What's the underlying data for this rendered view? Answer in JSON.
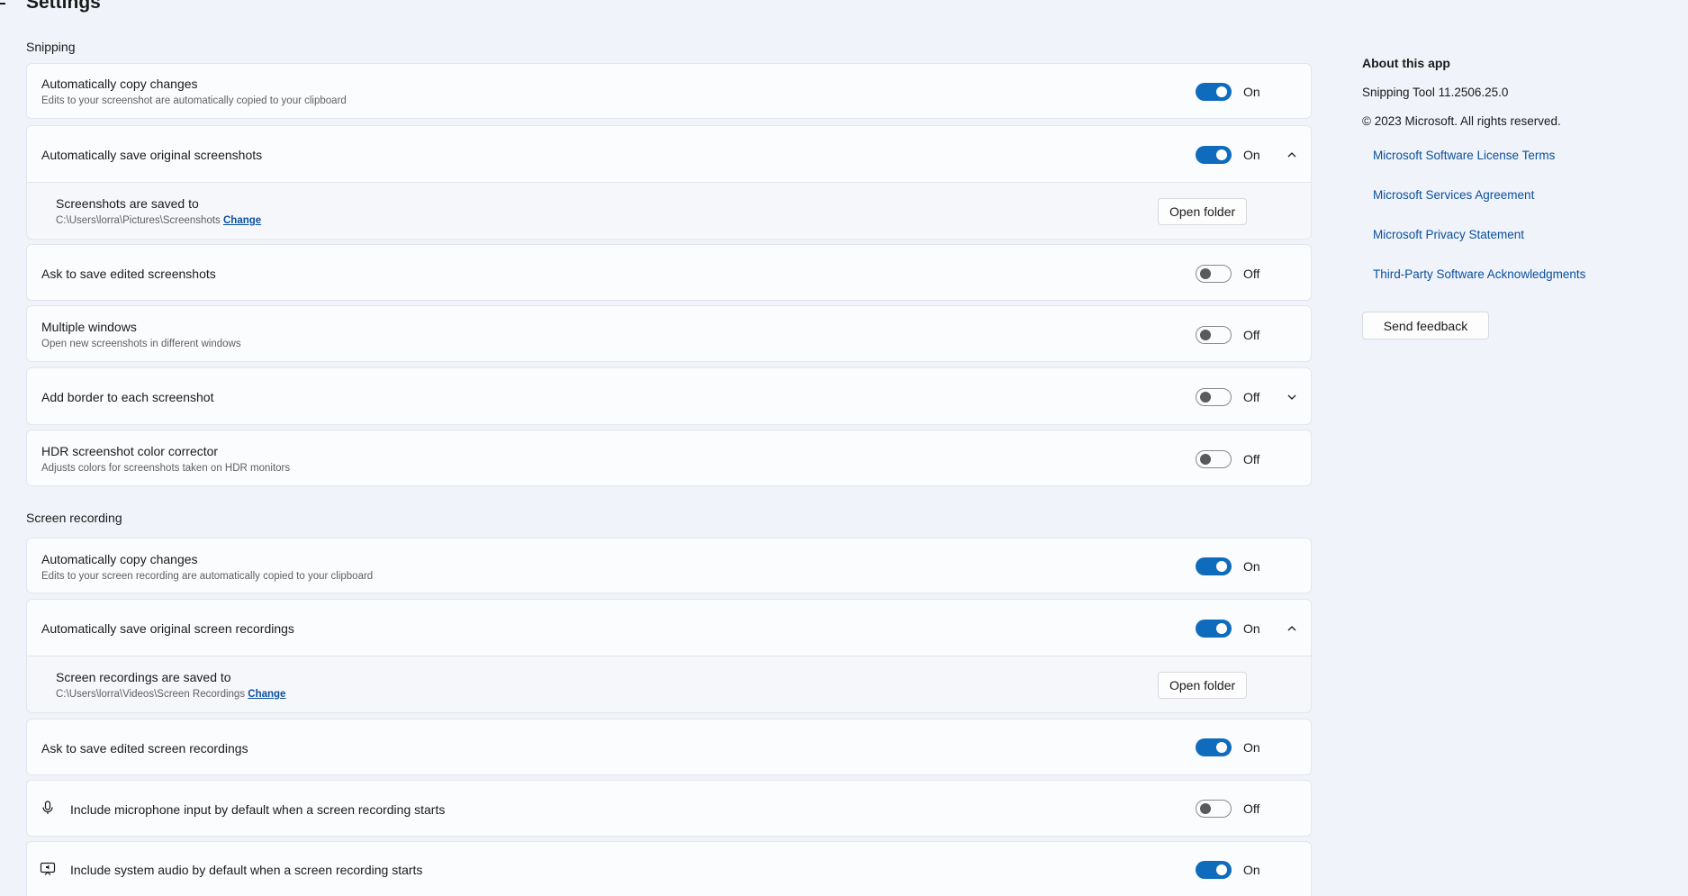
{
  "header": {
    "title": "Settings"
  },
  "snipping": {
    "title": "Snipping",
    "copy_changes": {
      "title": "Automatically copy changes",
      "desc": "Edits to your screenshot are automatically copied to your clipboard",
      "state": "On"
    },
    "save_originals": {
      "title": "Automatically save original screenshots",
      "state": "On"
    },
    "saved_to": {
      "title": "Screenshots are saved to",
      "path": "C:\\Users\\lorra\\Pictures\\Screenshots",
      "change": "Change",
      "button": "Open folder"
    },
    "ask_save": {
      "title": "Ask to save edited screenshots",
      "state": "Off"
    },
    "multiple_windows": {
      "title": "Multiple windows",
      "desc": "Open new screenshots in different windows",
      "state": "Off"
    },
    "add_border": {
      "title": "Add border to each screenshot",
      "state": "Off"
    },
    "hdr": {
      "title": "HDR screenshot color corrector",
      "desc": "Adjusts colors for screenshots taken on HDR monitors",
      "state": "Off"
    }
  },
  "recording": {
    "title": "Screen recording",
    "copy_changes": {
      "title": "Automatically copy changes",
      "desc": "Edits to your screen recording are automatically copied to your clipboard",
      "state": "On"
    },
    "save_originals": {
      "title": "Automatically save original screen recordings",
      "state": "On"
    },
    "saved_to": {
      "title": "Screen recordings are saved to",
      "path": "C:\\Users\\lorra\\Videos\\Screen Recordings",
      "change": "Change",
      "button": "Open folder"
    },
    "ask_save": {
      "title": "Ask to save edited screen recordings",
      "state": "On"
    },
    "microphone": {
      "title": "Include microphone input by default when a screen recording starts",
      "state": "Off",
      "icon": "microphone-icon"
    },
    "system_audio": {
      "title": "Include system audio by default when a screen recording starts",
      "state": "On",
      "icon": "speaker-screen-icon"
    }
  },
  "about": {
    "title": "About this app",
    "version": "Snipping Tool 11.2506.25.0",
    "copyright": "© 2023 Microsoft. All rights reserved.",
    "links": [
      "Microsoft Software License Terms",
      "Microsoft Services Agreement",
      "Microsoft Privacy Statement",
      "Third-Party Software Acknowledgments"
    ],
    "feedback": "Send feedback"
  },
  "colors": {
    "accent": "#0f6cbd",
    "link": "#0a4f9e",
    "background": "#f0f3f9",
    "card": "#fbfcfe"
  }
}
